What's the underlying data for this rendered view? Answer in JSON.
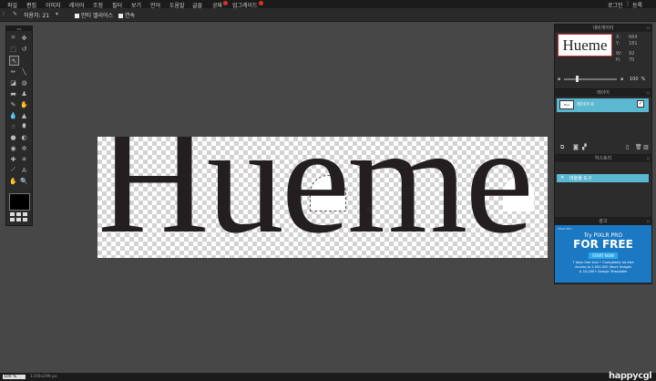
{
  "menu": [
    {
      "label": "파일"
    },
    {
      "label": "편집"
    },
    {
      "label": "이미지"
    },
    {
      "label": "레이어"
    },
    {
      "label": "조정"
    },
    {
      "label": "필터"
    },
    {
      "label": "보기"
    },
    {
      "label": "언어"
    },
    {
      "label": "도움말"
    },
    {
      "label": "글꼴"
    },
    {
      "label": "공짜",
      "badge": true
    },
    {
      "label": "업그레이드",
      "badge": true
    }
  ],
  "account": {
    "login": "로그인",
    "register": "등록"
  },
  "tool_options": {
    "tolerance_label": "허용치: 21",
    "antialias_label": "안티 앨리어스",
    "contiguous_label": "연속"
  },
  "canvas": {
    "text": "Hueme"
  },
  "navigator": {
    "title": "네비게이터",
    "thumb_text": "Hueme",
    "x_label": "X:",
    "x_value": "664",
    "y_label": "Y:",
    "y_value": "181",
    "w_label": "W:",
    "w_value": "92",
    "h_label": "H:",
    "h_value": "70",
    "zoom": "100",
    "zoom_unit": "%"
  },
  "layers": {
    "title": "레이어",
    "layer_name": "레이어 0"
  },
  "history": {
    "title": "히스토리",
    "item": "마술봉 도구"
  },
  "ad": {
    "title": "광고",
    "brand": "PIXLR PRO",
    "headline": "Try PIXLR PRO",
    "big": "FOR FREE",
    "button": "START NOW",
    "line1": "7 days free trial • Completely ad-free",
    "line2": "Access to 2,000,000 Stock Images",
    "line3": "& 10,000+ Design Templates"
  },
  "status": {
    "zoom": "100",
    "zoom_unit": "%",
    "size": "1100x299 px",
    "watermark": "happycgl"
  },
  "colors": {
    "layer_selected": "#5ab8d0",
    "ad_bg": "#1b78c2",
    "badge": "#d8312a"
  }
}
